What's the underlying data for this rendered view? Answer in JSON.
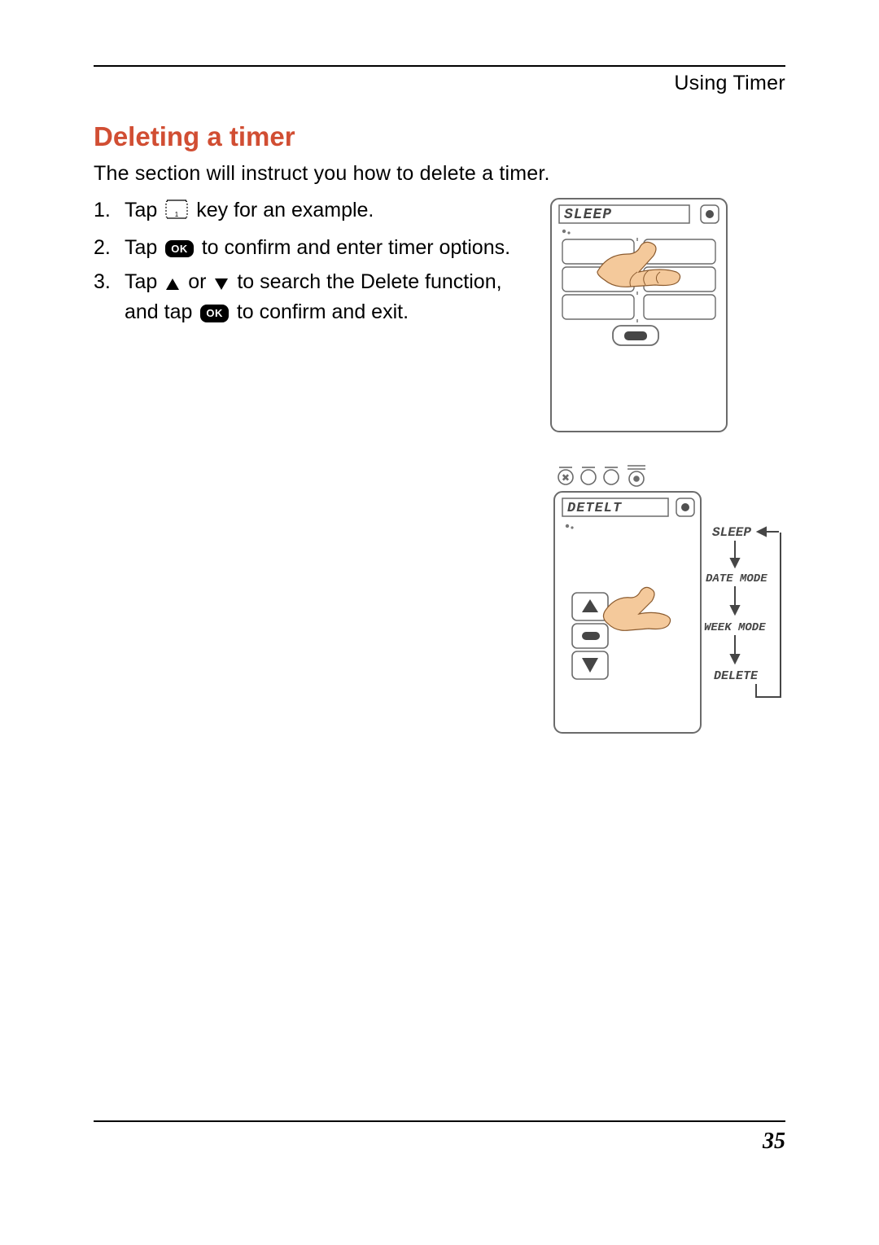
{
  "runningHead": "Using Timer",
  "heading": "Deleting a timer",
  "intro": "The section will instruct you how to delete a timer.",
  "okLabel": "OK",
  "steps": {
    "s1": {
      "a": "Tap ",
      "b": " key for an example."
    },
    "s2": {
      "a": "Tap ",
      "b": " to confirm and enter timer options."
    },
    "s3": {
      "a": "Tap ",
      "b": " or ",
      "c": " to search the Delete function, and tap ",
      "d": " to confirm and exit."
    }
  },
  "figure1": {
    "displayLabel": "SLEEP"
  },
  "figure2": {
    "displayLabel": "DETELT",
    "menu": [
      "SLEEP",
      "DATE MODE",
      "WEEK MODE",
      "DELETE"
    ]
  },
  "pageNumber": "35"
}
